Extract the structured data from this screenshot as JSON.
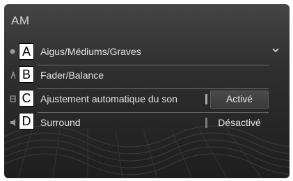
{
  "header": {
    "title": "AM"
  },
  "menu": [
    {
      "callout": "A",
      "label": "Aigus/Médiums/Graves",
      "icon": "tone-icon",
      "value": null
    },
    {
      "callout": "B",
      "label": "Fader/Balance",
      "icon": "speaker-balance-icon",
      "value": null
    },
    {
      "callout": "C",
      "label": "Ajustement automatique du son",
      "icon": "auto-sound-icon",
      "value": "Activé"
    },
    {
      "callout": "D",
      "label": "Surround",
      "icon": "surround-icon",
      "value": "Désactivé"
    }
  ],
  "colors": {
    "background": "#2e2e2e",
    "text": "#e4e4e4",
    "divider": "#6a6a6a"
  }
}
